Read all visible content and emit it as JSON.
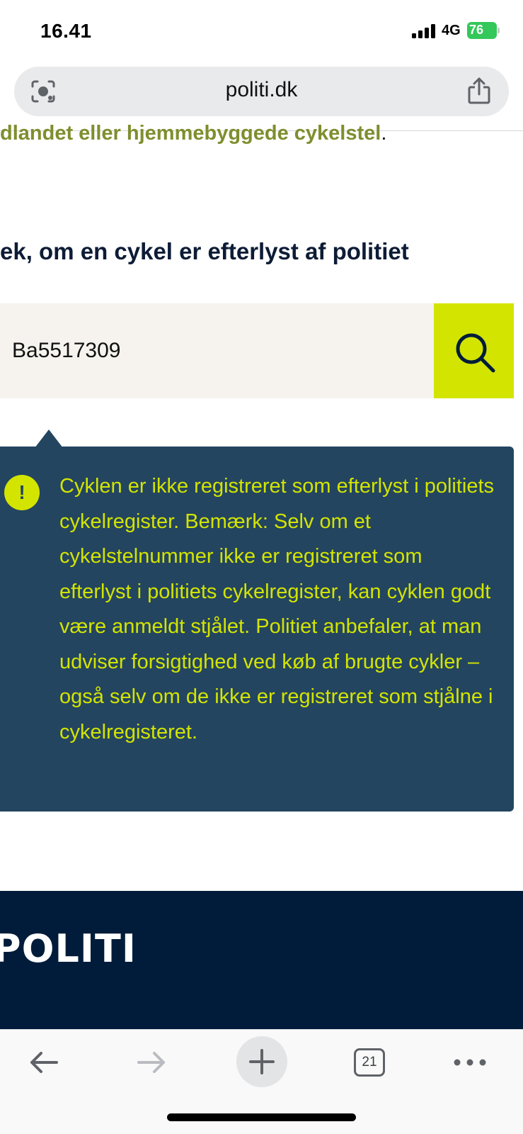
{
  "status_bar": {
    "time": "16.41",
    "network": "4G",
    "battery": "76"
  },
  "browser": {
    "url": "politi.dk",
    "tab_count": "21"
  },
  "page": {
    "partial_text": "dlandet eller hjemmebyggede cykelstel",
    "partial_text_end": ".",
    "section_heading": "ek, om en cykel er efterlyst af politiet",
    "search_value": "Ba5517309",
    "alert_symbol": "!",
    "result_message": "Cyklen er ikke registreret som efterlyst i politiets cykelregister. Bemærk: Selv om et cykelstelnummer ikke er registreret som efterlyst i politiets cykelregister, kan cyklen godt være anmeldt stjålet. Politiet anbefaler, at man udviser forsigtighed ved køb af brugte cykler – også selv om de ikke er registreret som stjålne i cykelregisteret."
  },
  "footer": {
    "logo_text": "POLITI"
  },
  "colors": {
    "accent": "#d3e400",
    "result_background": "#234560",
    "footer_background": "#001c3a",
    "heading": "#0d1c36",
    "link_green": "#7f8e2e"
  },
  "icons": {
    "url_left": "camera-search-icon",
    "share": "share-icon",
    "search": "search-icon",
    "alert": "exclamation-icon",
    "back": "arrow-left-icon",
    "forward": "arrow-right-icon",
    "new_tab": "plus-icon",
    "tabs": "tabs-icon",
    "more": "more-dots-icon"
  }
}
